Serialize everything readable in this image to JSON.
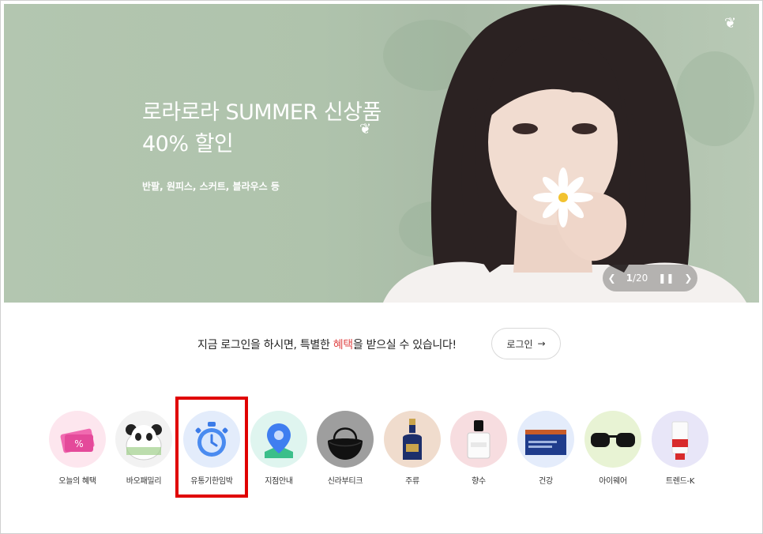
{
  "banner": {
    "title_line1": "로라로라 SUMMER 신상품",
    "title_line2": "40% 할인",
    "subtitle": "반팔, 원피스, 스커트, 블라우스 등",
    "pager": {
      "current": "1",
      "separator": "/",
      "total": "20"
    }
  },
  "login": {
    "text_before": "지금 로그인을 하시면, 특별한 ",
    "text_highlight": "혜택",
    "text_after": "을 받으실 수 있습니다!",
    "button_label": "로그인",
    "button_arrow": "→",
    "highlight_color": "#e04b4b"
  },
  "categories": [
    {
      "label": "오늘의 혜택",
      "icon": "coupon-icon",
      "bg": "#fde6ee"
    },
    {
      "label": "바오패밀리",
      "icon": "panda-icon",
      "bg": "#f2f2f2"
    },
    {
      "label": "유통기한임박",
      "icon": "stopwatch-icon",
      "bg": "#e3ecfb"
    },
    {
      "label": "지점안내",
      "icon": "map-pin-icon",
      "bg": "#dff5ef"
    },
    {
      "label": "신라부티크",
      "icon": "handbag-icon",
      "bg": "#9e9e9e"
    },
    {
      "label": "주류",
      "icon": "liquor-bottle-icon",
      "bg": "#f0dccd"
    },
    {
      "label": "향수",
      "icon": "perfume-icon",
      "bg": "#f7dde0"
    },
    {
      "label": "건강",
      "icon": "supplement-box-icon",
      "bg": "#e4ecfb"
    },
    {
      "label": "아이웨어",
      "icon": "sunglasses-icon",
      "bg": "#e8f3d4"
    },
    {
      "label": "트렌드-K",
      "icon": "cream-tube-icon",
      "bg": "#e8e6f8"
    }
  ],
  "highlight": {
    "color": "#e00000",
    "target": "유통기한임박"
  }
}
